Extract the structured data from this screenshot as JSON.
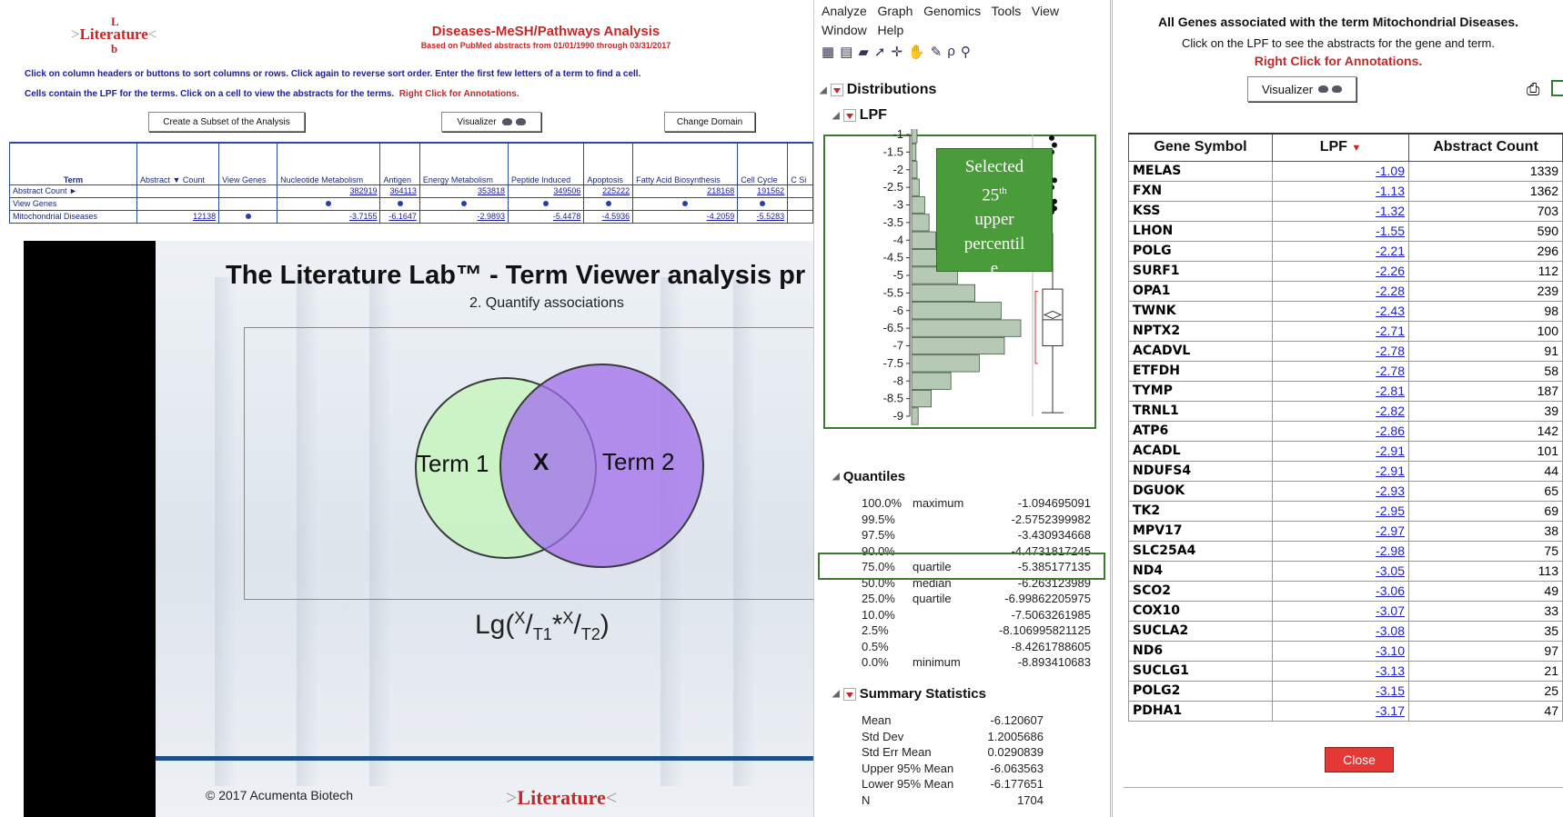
{
  "left": {
    "logo": {
      "main": "Literature",
      "top_letter": "L",
      "bottom_letter": "b"
    },
    "title": "Diseases-MeSH/Pathways Analysis",
    "subtitle": "Based on PubMed abstracts from 01/01/1990 through 03/31/2017",
    "instruction1": "Click on column headers or buttons to sort columns or rows.  Click again to reverse sort order.  Enter the first few letters of a term to find a cell.",
    "instruction2": "Cells contain the LPF for the terms.  Click on a cell to view the abstracts for the terms.",
    "instruction2_red": "Right Click for Annotations.",
    "buttons": {
      "subset": "Create a Subset of the Analysis",
      "visualizer": "Visualizer",
      "change_domain": "Change Domain"
    },
    "table": {
      "headers": [
        "Term",
        "Abstract ▼ Count",
        "View Genes",
        "Nucleotide Metabolism",
        "Antigen",
        "Energy Metabolism",
        "Peptide Induced",
        "Apoptosis",
        "Fatty Acid Biosynthesis",
        "Cell Cycle",
        "C Si"
      ],
      "rows": [
        {
          "label": "Abstract Count ►",
          "values": [
            "",
            "",
            "382919",
            "364113",
            "353818",
            "349506",
            "225222",
            "218168",
            "191562",
            ""
          ]
        },
        {
          "label": "View Genes",
          "values": [
            "",
            "",
            "•",
            "•",
            "•",
            "•",
            "•",
            "•",
            "•",
            ""
          ]
        },
        {
          "label": "Mitochondrial Diseases",
          "values": [
            "12138",
            "•",
            "-3.7155",
            "-6.1647",
            "-2.9893",
            "-5.4478",
            "-4.5936",
            "-4.2059",
            "-5.5283",
            ""
          ]
        }
      ]
    },
    "slide": {
      "title": "The Literature Lab™ - Term Viewer analysis pr",
      "subtitle": "2. Quantify associations",
      "term1": "Term 1",
      "x": "X",
      "term2": "Term 2",
      "formula": "Lg(X/T1*X/T2)",
      "copyright": "© 2017 Acumenta Biotech",
      "logo": "Literature"
    }
  },
  "jmp": {
    "menu_row1": [
      "Analyze",
      "Graph",
      "Genomics",
      "Tools",
      "View"
    ],
    "menu_row2": [
      "Window",
      "Help"
    ],
    "distributions": "Distributions",
    "lpf": "LPF",
    "axis_ticks": [
      "-1",
      "-1.5",
      "-2",
      "-2.5",
      "-3",
      "-3.5",
      "-4",
      "-4.5",
      "-5",
      "-5.5",
      "-6",
      "-6.5",
      "-7",
      "-7.5",
      "-8",
      "-8.5",
      "-9"
    ],
    "histogram": [
      {
        "bin": -1,
        "rel": 0.05
      },
      {
        "bin": -1.5,
        "rel": 0.04
      },
      {
        "bin": -2,
        "rel": 0.05
      },
      {
        "bin": -2.5,
        "rel": 0.07
      },
      {
        "bin": -3,
        "rel": 0.12
      },
      {
        "bin": -3.5,
        "rel": 0.16
      },
      {
        "bin": -4,
        "rel": 0.22
      },
      {
        "bin": -4.5,
        "rel": 0.34
      },
      {
        "bin": -5,
        "rel": 0.42
      },
      {
        "bin": -5.5,
        "rel": 0.58
      },
      {
        "bin": -6,
        "rel": 0.82
      },
      {
        "bin": -6.5,
        "rel": 1.0
      },
      {
        "bin": -7,
        "rel": 0.85
      },
      {
        "bin": -7.5,
        "rel": 0.62
      },
      {
        "bin": -8,
        "rel": 0.36
      },
      {
        "bin": -8.5,
        "rel": 0.18
      },
      {
        "bin": -9,
        "rel": 0.06
      }
    ],
    "callout": {
      "line1": "Selected",
      "line2_pre": "25",
      "line2_sup": "th",
      "line3": "upper",
      "line4": "percentil",
      "line5": "e"
    },
    "quantiles_title": "Quantiles",
    "quantiles": [
      {
        "p": "100.0%",
        "name": "maximum",
        "value": "-1.094695091"
      },
      {
        "p": "99.5%",
        "name": "",
        "value": "-2.5752399982"
      },
      {
        "p": "97.5%",
        "name": "",
        "value": "-3.430934668"
      },
      {
        "p": "90.0%",
        "name": "",
        "value": "-4.4731817245"
      },
      {
        "p": "75.0%",
        "name": "quartile",
        "value": "-5.385177135"
      },
      {
        "p": "50.0%",
        "name": "median",
        "value": "-6.263123989"
      },
      {
        "p": "25.0%",
        "name": "quartile",
        "value": "-6.99862205975"
      },
      {
        "p": "10.0%",
        "name": "",
        "value": "-7.5063261985"
      },
      {
        "p": "2.5%",
        "name": "",
        "value": "-8.106995821125"
      },
      {
        "p": "0.5%",
        "name": "",
        "value": "-8.4261788605"
      },
      {
        "p": "0.0%",
        "name": "minimum",
        "value": "-8.893410683"
      }
    ],
    "summary_title": "Summary Statistics",
    "summary": [
      {
        "k": "Mean",
        "v": "-6.120607"
      },
      {
        "k": "Std Dev",
        "v": "1.2005686"
      },
      {
        "k": "Std Err Mean",
        "v": "0.0290839"
      },
      {
        "k": "Upper 95% Mean",
        "v": "-6.063563"
      },
      {
        "k": "Lower 95% Mean",
        "v": "-6.177651"
      },
      {
        "k": "N",
        "v": "1704"
      }
    ]
  },
  "genes": {
    "title": "All Genes associated with the term Mitochondrial Diseases.",
    "subtitle": "Click on the LPF to see the abstracts for the gene and term.",
    "annotation": "Right Click for Annotations.",
    "visualizer": "Visualizer",
    "columns": [
      "Gene Symbol",
      "LPF ▼",
      "Abstract Count"
    ],
    "rows": [
      [
        "MELAS",
        "-1.09",
        "1339"
      ],
      [
        "FXN",
        "-1.13",
        "1362"
      ],
      [
        "KSS",
        "-1.32",
        "703"
      ],
      [
        "LHON",
        "-1.55",
        "590"
      ],
      [
        "POLG",
        "-2.21",
        "296"
      ],
      [
        "SURF1",
        "-2.26",
        "112"
      ],
      [
        "OPA1",
        "-2.28",
        "239"
      ],
      [
        "TWNK",
        "-2.43",
        "98"
      ],
      [
        "NPTX2",
        "-2.71",
        "100"
      ],
      [
        "ACADVL",
        "-2.78",
        "91"
      ],
      [
        "ETFDH",
        "-2.78",
        "58"
      ],
      [
        "TYMP",
        "-2.81",
        "187"
      ],
      [
        "TRNL1",
        "-2.82",
        "39"
      ],
      [
        "ATP6",
        "-2.86",
        "142"
      ],
      [
        "ACADL",
        "-2.91",
        "101"
      ],
      [
        "NDUFS4",
        "-2.91",
        "44"
      ],
      [
        "DGUOK",
        "-2.93",
        "65"
      ],
      [
        "TK2",
        "-2.95",
        "69"
      ],
      [
        "MPV17",
        "-2.97",
        "38"
      ],
      [
        "SLC25A4",
        "-2.98",
        "75"
      ],
      [
        "ND4",
        "-3.05",
        "113"
      ],
      [
        "SCO2",
        "-3.06",
        "49"
      ],
      [
        "COX10",
        "-3.07",
        "33"
      ],
      [
        "SUCLA2",
        "-3.08",
        "35"
      ],
      [
        "ND6",
        "-3.10",
        "97"
      ],
      [
        "SUCLG1",
        "-3.13",
        "21"
      ],
      [
        "POLG2",
        "-3.15",
        "25"
      ],
      [
        "PDHA1",
        "-3.17",
        "47"
      ]
    ],
    "close": "Close"
  }
}
